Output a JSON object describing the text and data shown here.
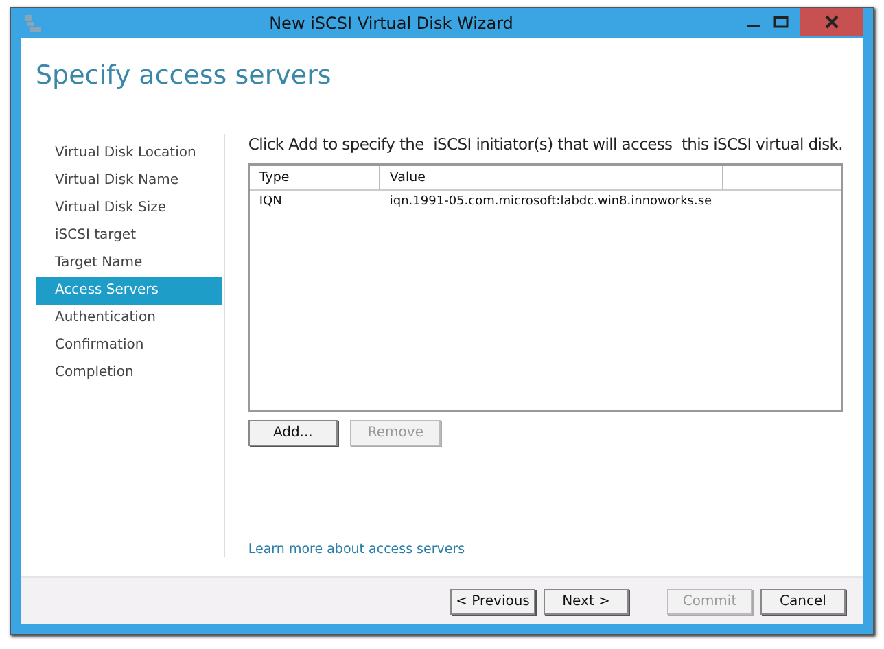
{
  "window": {
    "title": "New iSCSI Virtual Disk Wizard"
  },
  "heading": "Specify access servers",
  "steps": [
    {
      "label": "Virtual Disk Location",
      "selected": false
    },
    {
      "label": "Virtual Disk Name",
      "selected": false
    },
    {
      "label": "Virtual Disk Size",
      "selected": false
    },
    {
      "label": "iSCSI target",
      "selected": false
    },
    {
      "label": "Target Name",
      "selected": false
    },
    {
      "label": "Access Servers",
      "selected": true
    },
    {
      "label": "Authentication",
      "selected": false
    },
    {
      "label": "Confirmation",
      "selected": false
    },
    {
      "label": "Completion",
      "selected": false
    }
  ],
  "instruction": "Click Add to specify the  iSCSI initiator(s) that will access  this iSCSI virtual disk.",
  "table": {
    "columns": [
      "Type",
      "Value"
    ],
    "rows": [
      {
        "type": "IQN",
        "value": "iqn.1991-05.com.microsoft:labdc.win8.innoworks.se"
      }
    ]
  },
  "table_buttons": [
    {
      "label": "Add...",
      "disabled": false
    },
    {
      "label": "Remove",
      "disabled": true
    }
  ],
  "link": "Learn more about access servers",
  "footer_buttons": [
    {
      "label": "< Previous",
      "disabled": false
    },
    {
      "label": "Next >",
      "disabled": false
    },
    {
      "label": "Commit",
      "disabled": true
    },
    {
      "label": "Cancel",
      "disabled": false
    }
  ]
}
